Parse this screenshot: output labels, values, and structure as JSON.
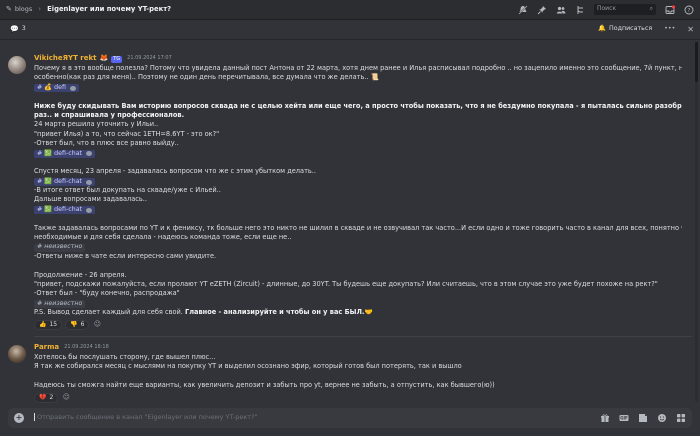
{
  "topbar": {
    "channel": "blogs",
    "thread_title": "Eigenlayer или почему YT-рект?",
    "search_placeholder": "Поиск"
  },
  "subbar": {
    "count": "3",
    "subscribe_label": "Подписаться"
  },
  "messages": [
    {
      "author": "VikicheЯYT rekt",
      "tag": "TG",
      "timestamp": "21.09.2024 17:07",
      "lines": [
        "Почему я в это вообще полезла? Потому что увидела данный пост Антона от 22 марта, хотя днем ранее и Илья расписывал подробно .. но зацепило именно это сообщение, 7й пункт, ну и продолжение",
        "особенно(как раз для меня).. Поэтому не один день перечитывала, все думала что же делать..",
        "Ниже буду скидывать Вам историю вопросов сквада не с целью хейта или еще чего, а просто чтобы показать, что я не бездумно покупала - я пыталась сильно разобраться вникнуть и не",
        "раз.. и спрашивала у профессионалов.",
        " 24 марта решила уточнить у Ильи..",
        "\"привет Илья) а то, что сейчас 1ETH=8.6YT - это ок?\"",
        "-Ответ был, что в плюс все равно выйду..",
        "Спустя месяц, 23 апреля - задавалась вопросом что же с этим убытком делать..",
        "-В итоге ответ был докупать на скваде/уже с Ильей..",
        "Дальше вопросами задавалась..",
        "Также задавалась вопросами по YT и к фениксу, тк больше него это никто не шилил в скваде и не озвучивал так часто...И если одно и тоже говорить часто в канал для всех, понятно что будет.. Выводы все",
        "необходимые и для себя сделала - надеюсь команда тоже, если еще не..",
        "-Ответы ниже в чате если интересно сами увидите.",
        "Продолжение - 26 апреля.",
        "\"привет, подскажи пожалуйста, если пролают YT eZETH (Zircuit) - длинные, до 30YT. Ты будешь еще докупать? Или считаешь, что в этом случае это уже будет похоже на рект?\"",
        "-Ответ был - \"буду конечно, распродажа\"",
        "P.S. Вывод сделает каждый для себя свой.",
        "Главное - анализируйте и чтобы он у вас БЫЛ."
      ],
      "mentions": {
        "defi": "defi",
        "defi_chat": "defi-chat",
        "unknown": "неизвестно"
      },
      "reactions": [
        {
          "emoji": "thumbs-up",
          "count": "15"
        },
        {
          "emoji": "thumbs-down",
          "count": "6"
        }
      ]
    },
    {
      "author": "Parma",
      "timestamp": "21.09.2024 18:18",
      "lines": [
        "Хотелось бы послушать сторону, где вышел плюс...",
        "Я так же собирался месяц с мыслями на покупку YT и выделил осознано эфир, который готов был потерять, так и  вышло",
        "Надеюсь ты сможга найти еще варианты, как увеличить депозит и забыть про yt, вернее не забыть, а отпустить, как бывшего(ю))"
      ],
      "reactions": [
        {
          "emoji": "broken-heart",
          "count": "2"
        }
      ]
    }
  ],
  "composer": {
    "placeholder": "Отправить сообщение в канал \"Eigenlayer или почему YT-рект?\""
  },
  "colors": {
    "bg": "#313338",
    "accent": "#5865f2",
    "author": "#f0b232"
  }
}
